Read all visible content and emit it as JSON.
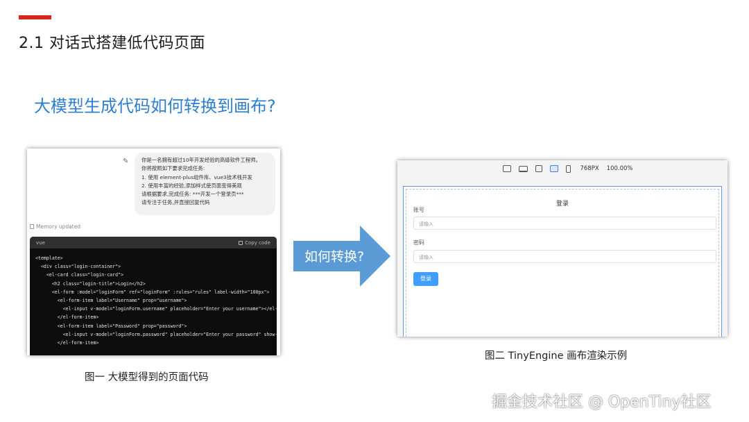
{
  "slide": {
    "section_title": "2.1 对话式搭建低代码页面",
    "subtitle": "大模型生成代码如何转换到画布?",
    "accent_color": "#d9261c",
    "subtitle_color": "#2f7fd1"
  },
  "chat_shot": {
    "edit_icon": "pencil-icon",
    "prompt_lines": [
      "你是一名拥有超过10年开发经验的高级软件工程师。",
      "你将按照如下要求完成任务:",
      "1. 使用 element-plus组件库、vue3技术栈开发",
      "2. 使用丰富的经验,添加样式使页面变得美观",
      "请根据要求,完成任务: ***开发一个登录页***",
      "请专注于任务,并直接回复代码"
    ],
    "memory_status": "Memory updated",
    "code_lang": "vue",
    "copy_label": "Copy code",
    "code_lines": [
      "<template>",
      "  <div class=\"login-container\">",
      "    <el-card class=\"login-card\">",
      "      <h2 class=\"login-title\">Login</h2>",
      "      <el-form :model=\"loginForm\" ref=\"loginForm\" :rules=\"rules\" label-width=\"100px\">",
      "        <el-form-item label=\"Username\" prop=\"username\">",
      "          <el-input v-model=\"loginForm.username\" placeholder=\"Enter your username\"></el-in",
      "        </el-form-item>",
      "",
      "        <el-form-item label=\"Password\" prop=\"password\">",
      "          <el-input v-model=\"loginForm.password\" placeholder=\"Enter your password\" show-pa",
      "        </el-form-item>"
    ],
    "caption": "图一  大模型得到的页面代码"
  },
  "arrow": {
    "label": "如何转换?",
    "color": "#5b9bd5"
  },
  "canvas_shot": {
    "device_icons": [
      "desktop-icon",
      "laptop-icon",
      "tablet-landscape-icon",
      "tablet-icon",
      "phone-icon"
    ],
    "active_device": "tablet-icon",
    "width_label": "768PX",
    "zoom_label": "100.00%",
    "login_title": "登录",
    "account_label": "账号",
    "account_placeholder": "请输入",
    "password_label": "密码",
    "password_placeholder": "请输入",
    "login_button": "登录",
    "button_color": "#409eff",
    "caption": "图二  TinyEngine 画布渲染示例"
  },
  "watermark": "掘金技术社区 @ OpenTiny社区"
}
